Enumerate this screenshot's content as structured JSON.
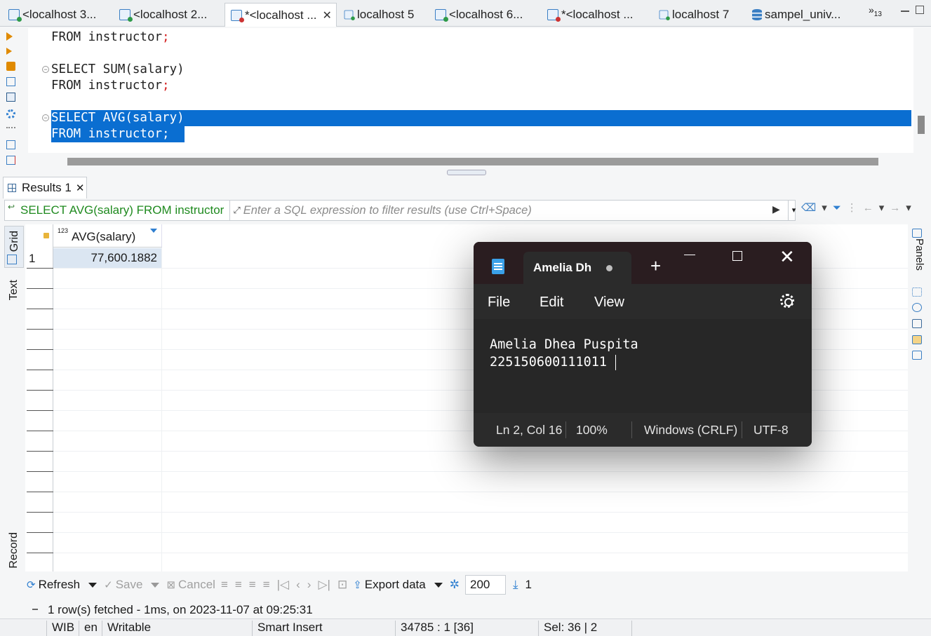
{
  "tabs": [
    {
      "label": "<localhost 3...",
      "icon": "sql-script-icon",
      "active": false
    },
    {
      "label": "<localhost 2...",
      "icon": "sql-script-icon",
      "active": false
    },
    {
      "label": "*<localhost ...",
      "icon": "sql-script-modified-icon",
      "active": true
    },
    {
      "label": "localhost 5",
      "icon": "sql-script-icon",
      "active": false
    },
    {
      "label": "<localhost 6...",
      "icon": "sql-script-icon",
      "active": false
    },
    {
      "label": "*<localhost ...",
      "icon": "sql-script-modified-icon",
      "active": false
    },
    {
      "label": "localhost 7",
      "icon": "sql-script-icon",
      "active": false
    },
    {
      "label": "sampel_univ...",
      "icon": "database-icon",
      "active": false
    }
  ],
  "tab_overflow": {
    "arrows": "»",
    "count": "13"
  },
  "editor": {
    "lines": [
      {
        "text": "FROM instructor",
        "semicolon": ";",
        "selected": false
      },
      {
        "text": "SELECT SUM(salary)",
        "semicolon": "",
        "selected": false
      },
      {
        "text": "FROM instructor",
        "semicolon": ";",
        "selected": false
      },
      {
        "text": "SELECT AVG(salary)",
        "semicolon": "",
        "selected": true
      },
      {
        "text": "FROM instructor;",
        "semicolon": "",
        "selected": true
      }
    ]
  },
  "results": {
    "tab_label": "Results 1",
    "filter_query": "SELECT AVG(salary) FROM instructor",
    "filter_placeholder": "Enter a SQL expression to filter results (use Ctrl+Space)",
    "side_tabs": [
      "Grid",
      "Text",
      "Record"
    ],
    "panels_label": "Panels",
    "column": {
      "type_badge": "123",
      "name": "AVG(salary)"
    },
    "rows": [
      {
        "num": "1",
        "value": "77,600.1882"
      }
    ]
  },
  "toolbar": {
    "refresh": "Refresh",
    "save": "Save",
    "cancel": "Cancel",
    "export": "Export data",
    "fetch_size": "200",
    "row_count": "1"
  },
  "status_message": "1 row(s) fetched - 1ms, on 2023-11-07 at 09:25:31",
  "statusbar": {
    "timezone": "WIB",
    "locale": "en",
    "mode": "Writable",
    "insert_mode": "Smart Insert",
    "position": "34785 : 1 [36]",
    "selection": "Sel: 36 | 2"
  },
  "notepad": {
    "tab_title": "Amelia Dh",
    "menu": [
      "File",
      "Edit",
      "View"
    ],
    "content_lines": [
      "Amelia Dhea Puspita",
      "225150600111011"
    ],
    "status": {
      "position": "Ln 2, Col 16",
      "zoom": "100%",
      "line_ending": "Windows (CRLF)",
      "encoding": "UTF-8"
    }
  }
}
